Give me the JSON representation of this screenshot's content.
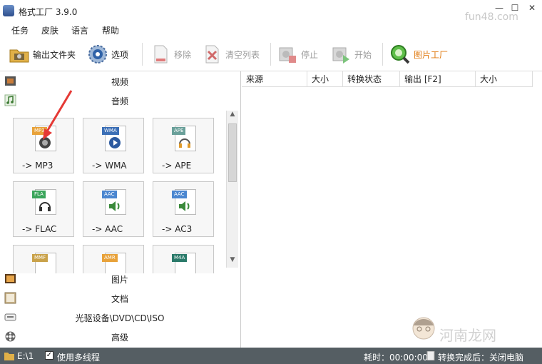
{
  "window": {
    "title": "格式工厂 3.9.0",
    "watermark_top": "fun48.com",
    "minimize": "—",
    "maximize": "☐",
    "close": "✕"
  },
  "menu": [
    "任务",
    "皮肤",
    "语言",
    "帮助"
  ],
  "toolbar": {
    "output_folder": "输出文件夹",
    "options": "选项",
    "remove": "移除",
    "clear_list": "清空列表",
    "stop": "停止",
    "start": "开始",
    "picture_factory": "图片工厂"
  },
  "categories": {
    "video": "视频",
    "audio": "音频",
    "picture": "图片",
    "document": "文档",
    "rom": "光驱设备\\DVD\\CD\\ISO",
    "advanced": "高级"
  },
  "audio_formats": [
    {
      "label": "-> MP3",
      "tag": "MP3"
    },
    {
      "label": "-> WMA",
      "tag": "WMA"
    },
    {
      "label": "-> APE",
      "tag": "APE"
    },
    {
      "label": "-> FLAC",
      "tag": "FLA"
    },
    {
      "label": "-> AAC",
      "tag": "AAC"
    },
    {
      "label": "-> AC3",
      "tag": "AAC"
    },
    {
      "label": "",
      "tag": "MMF"
    },
    {
      "label": "",
      "tag": "AMR"
    },
    {
      "label": "",
      "tag": "M4A"
    }
  ],
  "columns": [
    "来源",
    "大小",
    "转换状态",
    "输出 [F2]",
    "大小"
  ],
  "watermark_bottom": "河南龙网",
  "status": {
    "drive": "E:\\1",
    "multithread_label": "使用多线程",
    "multithread_checked": "✓",
    "elapsed": "耗时：00:00:00",
    "after_done": "转换完成后：关闭电脑"
  },
  "colors": {
    "accent_orange": "#e8a23a",
    "status_bg": "#555e63",
    "arrow": "#e53935"
  }
}
